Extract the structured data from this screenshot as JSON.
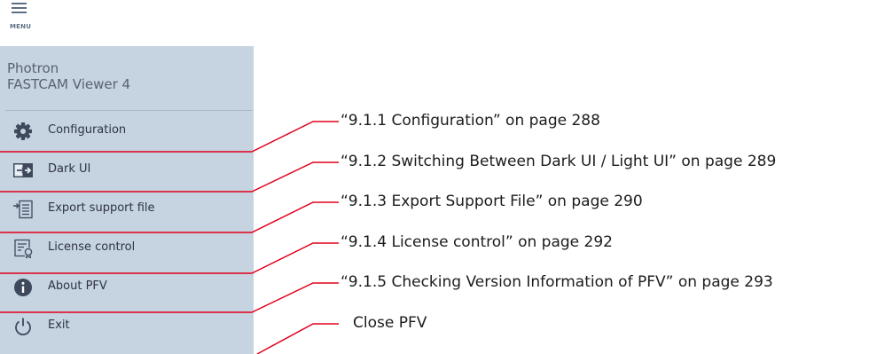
{
  "menu_button": {
    "label": "MENU"
  },
  "app": {
    "title_line1": "Photron",
    "title_line2": "FASTCAM Viewer 4"
  },
  "menu_items": [
    {
      "label": "Configuration",
      "icon": "gear-icon"
    },
    {
      "label": "Dark UI",
      "icon": "theme-switch-icon"
    },
    {
      "label": "Export support file",
      "icon": "export-file-icon"
    },
    {
      "label": "License control",
      "icon": "license-icon"
    },
    {
      "label": "About PFV",
      "icon": "info-icon"
    },
    {
      "label": "Exit",
      "icon": "power-icon"
    }
  ],
  "callouts": [
    "“9.1.1 Configuration” on page 288",
    "“9.1.2 Switching Between Dark UI / Light UI” on page 289",
    "“9.1.3 Export Support File” on page 290",
    "“9.1.4 License control” on page 292",
    "“9.1.5 Checking Version Information of PFV” on page 293",
    "Close PFV"
  ],
  "colors": {
    "panel": "#c6d3e1",
    "icon": "#3e4a5c",
    "leader_line": "#e0001b"
  }
}
